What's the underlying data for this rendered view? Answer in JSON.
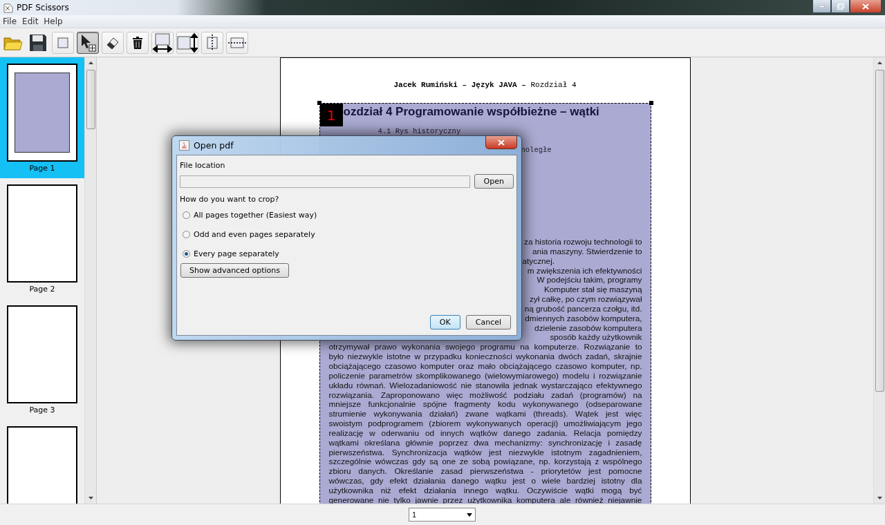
{
  "window": {
    "title": "PDF Scissors"
  },
  "menu": [
    "File",
    "Edit",
    "Help"
  ],
  "toolbar": [
    {
      "kind": "open",
      "selected": false
    },
    {
      "kind": "save",
      "selected": false
    },
    {
      "kind": "crop",
      "selected": false
    },
    {
      "kind": "select",
      "selected": true
    },
    {
      "kind": "erase",
      "selected": false
    },
    {
      "kind": "delete",
      "selected": false
    },
    {
      "kind": "equal-width",
      "selected": false
    },
    {
      "kind": "equal-height",
      "selected": false
    },
    {
      "kind": "split-vertical",
      "selected": false
    },
    {
      "kind": "split-horizontal",
      "selected": false
    }
  ],
  "pages": [
    {
      "label": "Page 1",
      "selected": true,
      "cropped": true
    },
    {
      "label": "Page 2",
      "selected": false,
      "cropped": false
    },
    {
      "label": "Page 3",
      "selected": false,
      "cropped": false
    },
    {
      "selected": false,
      "cropped": false
    }
  ],
  "document": {
    "header": "**Jacek Rumiński – Język JAVA –** Rozdział 4",
    "crop_number": "1",
    "heading": "ozdział 4  Programowanie współbieżne – wątki",
    "toc": [
      {
        "kind": "full",
        "text": "4.1 Rys historyczny"
      },
      {
        "kind": "fragment",
        "text": "noległe"
      }
    ],
    "lines": [
      {
        "kind": "fragment",
        "text": "za historia rozwoju technologii to"
      },
      {
        "kind": "fragment",
        "text": "ania maszyny. Stwierdzenie to"
      },
      {
        "kind": "fragment-end",
        "text": "atycznej."
      },
      {
        "kind": "fragment",
        "text": "m zwiększenia ich efektywności"
      },
      {
        "kind": "fragment",
        "text": "W podejściu takim, programy"
      },
      {
        "kind": "fragment",
        "text": "Komputer stał się maszyną"
      },
      {
        "kind": "fragment",
        "text": "zył całkę, po czym rozwiązywał"
      },
      {
        "kind": "fragment",
        "text": "ną grubość pancerza czołgu, itd."
      },
      {
        "kind": "fragment",
        "text": "dmiennych zasobów komputera,"
      },
      {
        "kind": "fragment",
        "text": "dzielenie zasobów komputera"
      },
      {
        "kind": "fragment",
        "text": "sposób każdy użytkownik"
      },
      {
        "kind": "full",
        "text": "otrzymywał prawo wykonania swojego programu na komputerze. Rozwiązanie to"
      },
      {
        "kind": "full",
        "text": "było niezwykle istotne w przypadku konieczności wykonania dwóch zadań, skrajnie"
      },
      {
        "kind": "full",
        "text": "obciążającego czasowo komputer oraz mało obciążającego czasowo komputer, np."
      },
      {
        "kind": "full",
        "text": "policzenie parametrów skomplikowanego (wielowymiarowego) modelu i rozwiązanie"
      },
      {
        "kind": "full",
        "text": "układu równań. Wielozadaniowość nie stanowiła jednak wystarczająco efektywnego"
      },
      {
        "kind": "full",
        "text": "rozwiązania. Zaproponowano więc możliwość podziału zadań (programów) na"
      },
      {
        "kind": "full",
        "text": "mniejsze funkcjonalnie spójne fragmenty kodu wykonywanego (odseparowane"
      },
      {
        "kind": "full",
        "text": "strumienie wykonywania działań) zwane wątkami (threads). Wątek jest więc"
      },
      {
        "kind": "full",
        "text": "swoistym podprogramem (zbiorem wykonywanych operacji) umożliwiającym jego"
      },
      {
        "kind": "full",
        "text": "realizację w oderwaniu od innych wątków danego zadania. Relacja pomiędzy"
      },
      {
        "kind": "full",
        "text": "wątkami określana głównie poprzez dwa mechanizmy: synchronizację i zasadę"
      },
      {
        "kind": "full",
        "text": "pierwszeństwa. Synchronizacja wątków jest niezwykle istotnym zagadnieniem,"
      },
      {
        "kind": "full",
        "text": "szczególnie wówczas gdy są one ze sobą powiązane, np. korzystają z wspólnego"
      },
      {
        "kind": "full",
        "text": "zbioru danych. Określanie zasad pierwszeństwa - priorytetów jest pomocne"
      },
      {
        "kind": "full",
        "text": "wówczas, gdy efekt działania danego wątku jest o wiele bardziej istotny dla"
      },
      {
        "kind": "full",
        "text": "użytkownika niż efekt działania innego wątku. Oczywiście wątki mogą być"
      },
      {
        "kind": "full",
        "text": "generowane nie tylko jawnie przez użytkownika komputera ale również niejawnie"
      }
    ]
  },
  "page_selector": {
    "value": "1"
  },
  "dialog": {
    "title": "Open pdf",
    "file_label": "File location",
    "open_button": "Open",
    "question": "How do you want to crop?",
    "options": [
      {
        "label": "All pages together (Easiest way)",
        "selected": false
      },
      {
        "label": "Odd and even pages separately",
        "selected": false
      },
      {
        "label": "Every page separately",
        "selected": true
      }
    ],
    "advanced_button": "Show advanced options",
    "buttons": [
      {
        "label": "OK",
        "kind": "default"
      },
      {
        "label": "Cancel",
        "kind": "normal"
      }
    ]
  }
}
